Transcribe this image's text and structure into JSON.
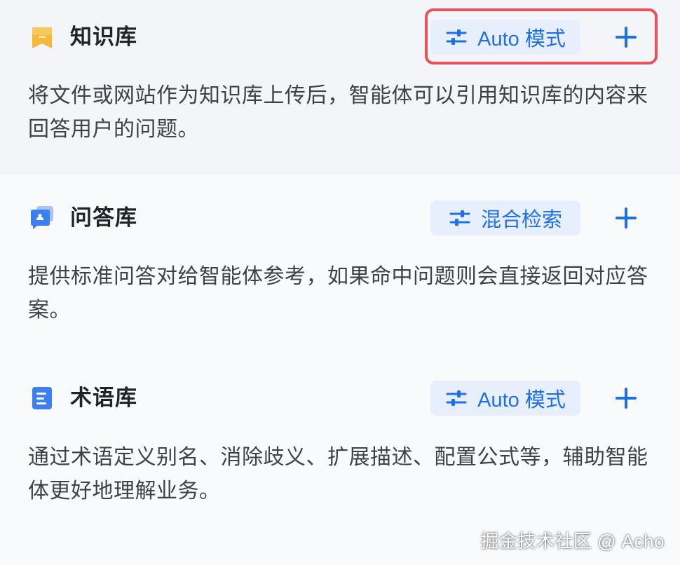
{
  "sections": [
    {
      "icon": "book-bookmark-icon",
      "title": "知识库",
      "mode_label": "Auto 模式",
      "description": "将文件或网站作为知识库上传后，智能体可以引用知识库的内容来回答用户的问题。"
    },
    {
      "icon": "chat-cards-icon",
      "title": "问答库",
      "mode_label": "混合检索",
      "description": "提供标准问答对给智能体参考，如果命中问题则会直接返回对应答案。"
    },
    {
      "icon": "document-list-icon",
      "title": "术语库",
      "mode_label": "Auto 模式",
      "description": "通过术语定义别名、消除歧义、扩展描述、配置公式等，辅助智能体更好地理解业务。"
    }
  ],
  "watermark": "掘金技术社区 @ Acho",
  "colors": {
    "accent": "#1f6fe8",
    "button_bg": "#e8effc",
    "highlight_border": "#e8535b",
    "title": "#1f2329",
    "description": "#3d4249"
  }
}
